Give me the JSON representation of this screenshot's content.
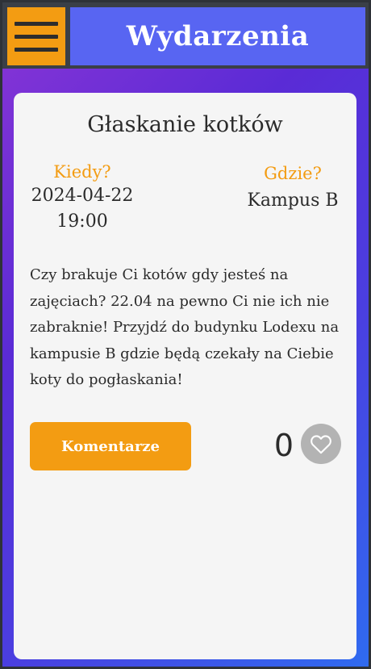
{
  "header": {
    "menu_icon": "hamburger-menu-icon",
    "title": "Wydarzenia"
  },
  "event": {
    "title": "Głaskanie kotków",
    "when_label": "Kiedy?",
    "date": "2024-04-22",
    "time": "19:00",
    "where_label": "Gdzie?",
    "location": "Kampus B",
    "description": "Czy brakuje Ci kotów gdy jesteś na zajęciach? 22.04 na pewno Ci nie ich nie zabraknie! Przyjdź do budynku Lodexu na kampusie B gdzie będą czekały na Ciebie koty do pogłaskania!",
    "comments_label": "Komentarze",
    "likes": "0",
    "like_icon": "heart-outline-icon"
  },
  "colors": {
    "accent": "#f39c12",
    "header_blue": "#5865f2",
    "heart_bg": "#b3b3b3"
  }
}
